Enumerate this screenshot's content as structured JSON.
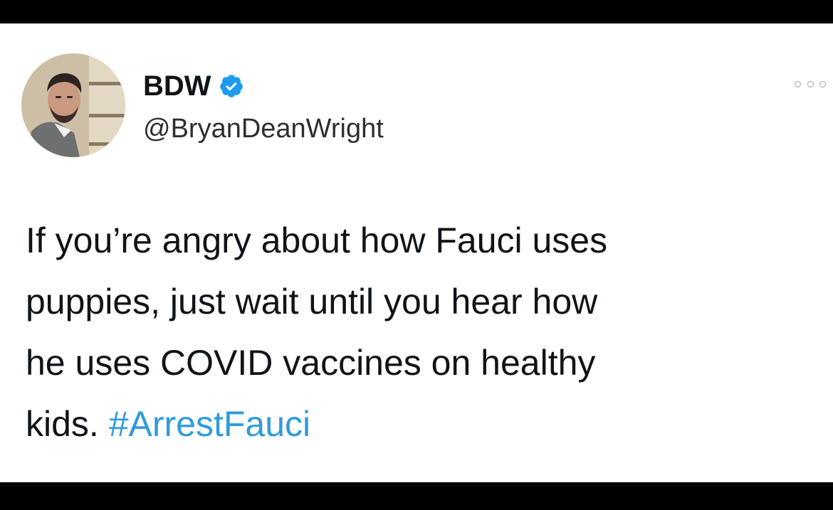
{
  "tweet": {
    "display_name": "BDW",
    "handle": "@BryanDeanWright",
    "verified": true,
    "verified_icon": "verified-badge-icon",
    "more_icon": "more-options-icon",
    "text_lines": [
      "If you’re angry about how Fauci uses",
      "puppies, just wait until you hear how",
      "he uses COVID vaccines on healthy",
      "kids. "
    ],
    "hashtag": "#ArrestFauci"
  },
  "colors": {
    "background": "#000000",
    "card": "#ffffff",
    "text": "#0f1419",
    "hashtag": "#2f9bdc",
    "verified": "#1d9bf0"
  }
}
